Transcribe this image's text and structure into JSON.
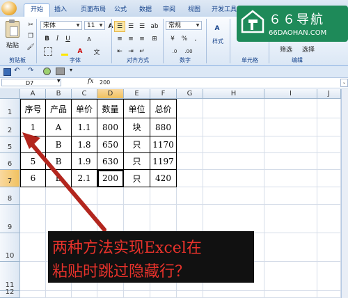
{
  "ribbon": {
    "office_button": "",
    "tabs": [
      "开始",
      "插入",
      "页面布局",
      "公式",
      "数据",
      "审阅",
      "视图",
      "开发工具"
    ],
    "active_tab": 0,
    "groups": {
      "clipboard": {
        "label": "剪贴板",
        "paste": "粘贴"
      },
      "font": {
        "label": "字体",
        "font_name": "宋体",
        "font_size": "11",
        "bold": "B",
        "italic": "I",
        "underline": "U",
        "grow": "A",
        "shrink": "A"
      },
      "alignment": {
        "label": "对齐方式"
      },
      "number": {
        "label": "数字",
        "format": "常规",
        "percent": "%",
        "comma": ","
      },
      "styles": {
        "label": "样式"
      },
      "cells": {
        "label": "单元格"
      },
      "editing": {
        "label": "编辑",
        "filter": "筛选",
        "select": "选择"
      }
    }
  },
  "formula_bar": {
    "name_box": "D7",
    "fx": "fx",
    "value": "200"
  },
  "columns": [
    "A",
    "B",
    "C",
    "D",
    "E",
    "F",
    "G",
    "H",
    "I",
    "J"
  ],
  "selected_column": "D",
  "rows": [
    "1",
    "2",
    "5",
    "6",
    "7",
    "8",
    "9",
    "10",
    "11",
    "12"
  ],
  "selected_row": "7",
  "table": {
    "headers": [
      "序号",
      "产品",
      "单价",
      "数量",
      "单位",
      "总价"
    ],
    "data": [
      [
        "1",
        "A",
        "1.1",
        "800",
        "块",
        "880"
      ],
      [
        "4",
        "B",
        "1.8",
        "650",
        "只",
        "1170"
      ],
      [
        "5",
        "B",
        "1.9",
        "630",
        "只",
        "1197"
      ],
      [
        "6",
        "B",
        "2.1",
        "200",
        "只",
        "420"
      ]
    ]
  },
  "watermark": {
    "brand": "６６导航",
    "url": "66DAOHAN.COM"
  },
  "overlay": {
    "line1": "两种方法实现Excel在",
    "line2": "粘贴时跳过隐藏行？"
  },
  "colors": {
    "accent": "#15428b",
    "ribbon": "#dbe7f5",
    "arrow": "#b3261e",
    "overlay_bg": "#111111",
    "overlay_text": "#e8322b",
    "watermark_bg": "#1e8a59"
  }
}
